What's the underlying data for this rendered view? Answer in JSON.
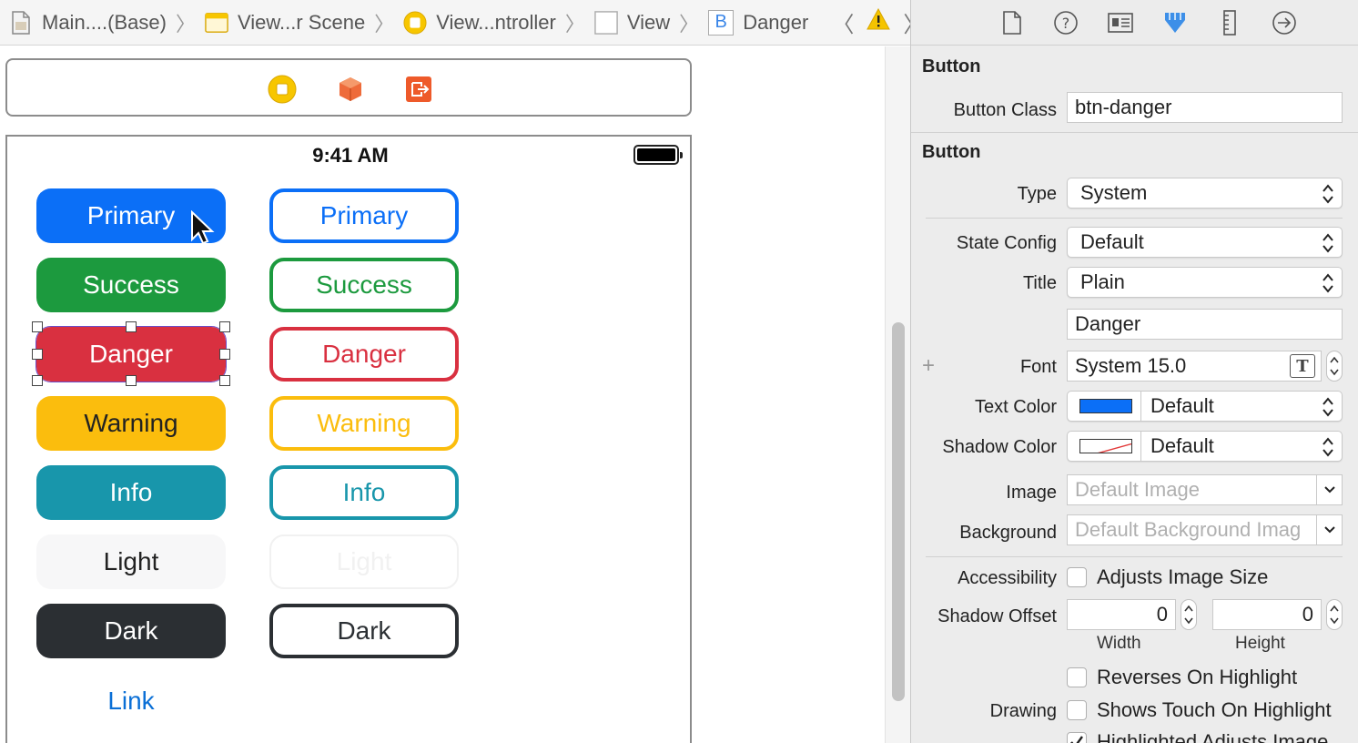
{
  "breadcrumb": [
    {
      "label": "Main....(Base)",
      "icon": "storyboard-file-icon"
    },
    {
      "label": "View...r Scene",
      "icon": "scene-icon"
    },
    {
      "label": "View...ntroller",
      "icon": "view-controller-icon"
    },
    {
      "label": "View",
      "icon": "view-icon"
    },
    {
      "label": "Danger",
      "icon": "button-object-icon"
    }
  ],
  "breadcrumb_button_glyph": "B",
  "status_bar": {
    "time": "9:41 AM"
  },
  "buttons_solid": [
    {
      "label": "Primary",
      "bg": "#0b6ff7",
      "fg": "#ffffff"
    },
    {
      "label": "Success",
      "bg": "#1c9a3e",
      "fg": "#ffffff"
    },
    {
      "label": "Danger",
      "bg": "#d93040",
      "fg": "#ffffff"
    },
    {
      "label": "Warning",
      "bg": "#fbbd0d",
      "fg": "#222222"
    },
    {
      "label": "Info",
      "bg": "#1896ab",
      "fg": "#ffffff"
    },
    {
      "label": "Light",
      "bg": "#f7f7f8",
      "fg": "#222222"
    },
    {
      "label": "Dark",
      "bg": "#2b2f33",
      "fg": "#ffffff"
    }
  ],
  "buttons_outline": [
    {
      "label": "Primary",
      "color": "#0b6ff7"
    },
    {
      "label": "Success",
      "color": "#1c9a3e"
    },
    {
      "label": "Danger",
      "color": "#d93040"
    },
    {
      "label": "Warning",
      "color": "#fbbd0d"
    },
    {
      "label": "Info",
      "color": "#1896ab"
    },
    {
      "label": "Light",
      "color": "#f1f1f1"
    },
    {
      "label": "Dark",
      "color": "#2b2f33"
    }
  ],
  "link_button": {
    "label": "Link",
    "color": "#0a6fd6"
  },
  "inspector": {
    "section1_title": "Button",
    "button_class_label": "Button Class",
    "button_class_value": "btn-danger",
    "section2_title": "Button",
    "type_label": "Type",
    "type_value": "System",
    "state_config_label": "State Config",
    "state_config_value": "Default",
    "title_label": "Title",
    "title_value": "Plain",
    "title_text": "Danger",
    "font_label": "Font",
    "font_value": "System 15.0",
    "font_plus": "+",
    "text_color_label": "Text Color",
    "text_color_value": "Default",
    "text_color_swatch": "#0b6ff7",
    "shadow_color_label": "Shadow Color",
    "shadow_color_value": "Default",
    "image_label": "Image",
    "image_placeholder": "Default Image",
    "background_label": "Background",
    "background_placeholder": "Default Background Imag",
    "accessibility_label": "Accessibility",
    "adjusts_image_size": "Adjusts Image Size",
    "shadow_offset_label": "Shadow Offset",
    "shadow_offset_width": "0",
    "shadow_offset_height": "0",
    "width_caption": "Width",
    "height_caption": "Height",
    "reverses_on_highlight": "Reverses On Highlight",
    "drawing_label": "Drawing",
    "shows_touch_on_highlight": "Shows Touch On Highlight",
    "highlighted_adjusts_image": "Highlighted Adjusts Image"
  }
}
